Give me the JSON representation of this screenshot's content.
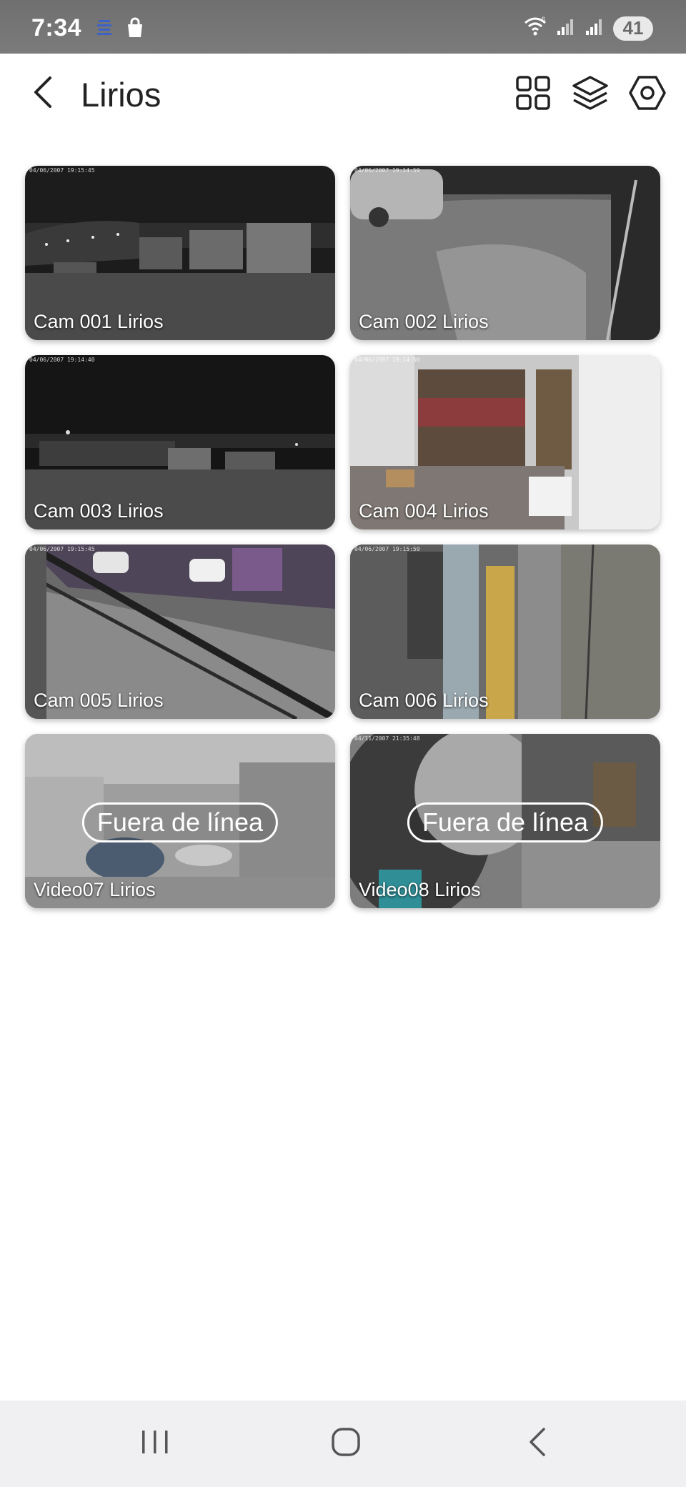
{
  "status_bar": {
    "time": "7:34",
    "battery": "41",
    "icons": [
      "signal-app-icon",
      "shopping-bag-icon",
      "wifi-icon",
      "cell-signal-icon",
      "cell-signal-icon"
    ]
  },
  "header": {
    "title": "Lirios",
    "icons": [
      "back-arrow-icon",
      "grid-view-icon",
      "layers-icon",
      "settings-hex-icon"
    ]
  },
  "cameras": [
    {
      "label": "Cam 001 Lirios",
      "offline": false,
      "stamp": "04/06/2007 19:15:45"
    },
    {
      "label": "Cam 002 Lirios",
      "offline": false,
      "stamp": "04/06/2007 19:14:59"
    },
    {
      "label": "Cam 003 Lirios",
      "offline": false,
      "stamp": "04/06/2007 19:14:40"
    },
    {
      "label": "Cam 004 Lirios",
      "offline": false,
      "stamp": "04/06/2007 19:14:50"
    },
    {
      "label": "Cam 005 Lirios",
      "offline": false,
      "stamp": "04/06/2007 19:15:45"
    },
    {
      "label": "Cam 006 Lirios",
      "offline": false,
      "stamp": "04/06/2007 19:15:50"
    },
    {
      "label": "Video07 Lirios",
      "offline": true,
      "stamp": ""
    },
    {
      "label": "Video08 Lirios",
      "offline": true,
      "stamp": "04/11/2007 21:35:48"
    }
  ],
  "offline_text": "Fuera de línea",
  "nav_bar": {
    "icons": [
      "recent-apps-icon",
      "home-icon",
      "back-icon"
    ]
  }
}
